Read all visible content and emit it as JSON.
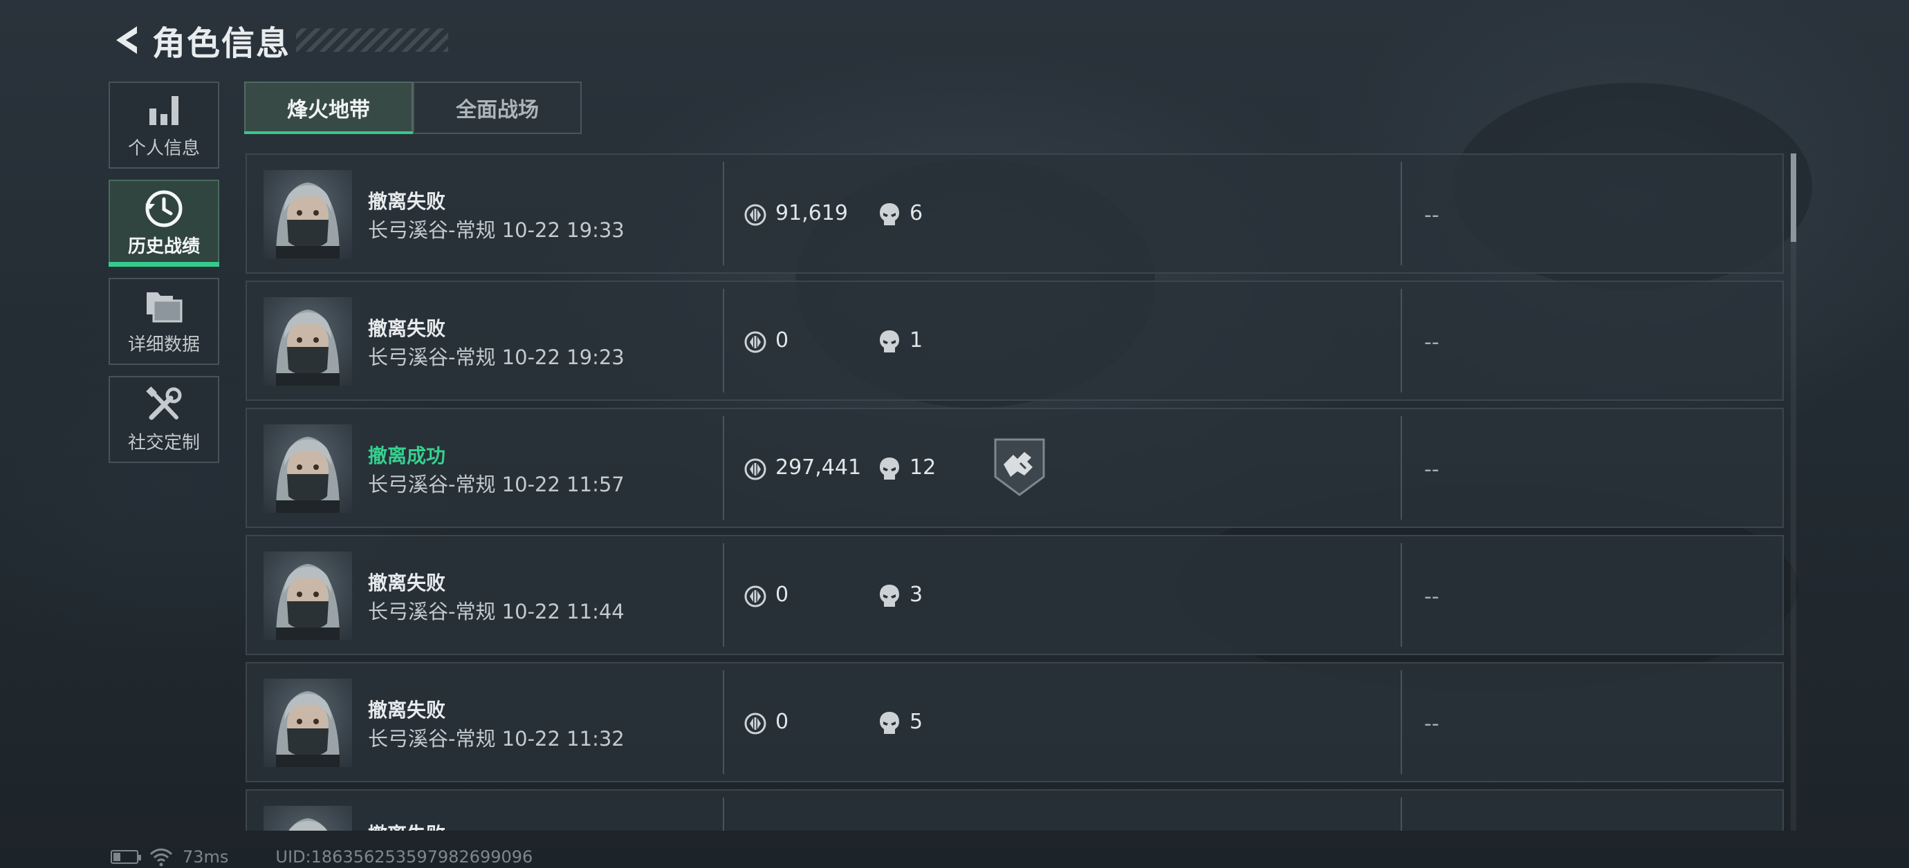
{
  "header": {
    "title": "角色信息"
  },
  "nav": {
    "items": [
      {
        "label": "个人信息",
        "icon": "bar-chart-icon",
        "active": false
      },
      {
        "label": "历史战绩",
        "icon": "history-clock-icon",
        "active": true
      },
      {
        "label": "详细数据",
        "icon": "folders-icon",
        "active": false
      },
      {
        "label": "社交定制",
        "icon": "wrench-screwdriver-icon",
        "active": false
      }
    ]
  },
  "tabs": [
    {
      "label": "烽火地带",
      "active": true
    },
    {
      "label": "全面战场",
      "active": false
    }
  ],
  "records": [
    {
      "status": "撤离失败",
      "result": "fail",
      "map": "长弓溪谷-常规 10-22 19:33",
      "value": "91,619",
      "kills": "6",
      "extra": "--"
    },
    {
      "status": "撤离失败",
      "result": "fail",
      "map": "长弓溪谷-常规 10-22 19:23",
      "value": "0",
      "kills": "1",
      "extra": "--"
    },
    {
      "status": "撤离成功",
      "result": "success",
      "map": "长弓溪谷-常规 10-22 11:57",
      "value": "297,441",
      "kills": "12",
      "extra": "--",
      "badge": "shield-badge-icon"
    },
    {
      "status": "撤离失败",
      "result": "fail",
      "map": "长弓溪谷-常规 10-22 11:44",
      "value": "0",
      "kills": "3",
      "extra": "--"
    },
    {
      "status": "撤离失败",
      "result": "fail",
      "map": "长弓溪谷-常规 10-22 11:32",
      "value": "0",
      "kills": "5",
      "extra": "--"
    },
    {
      "status": "撤离失败",
      "result": "fail",
      "map": "",
      "value": "",
      "kills": "",
      "extra": ""
    }
  ],
  "status_bar": {
    "ping": "73ms",
    "uid": "UID:1863562535979826990​96"
  },
  "colors": {
    "accent": "#36c98c",
    "success_text": "#36d08e",
    "background": "#20272e"
  }
}
